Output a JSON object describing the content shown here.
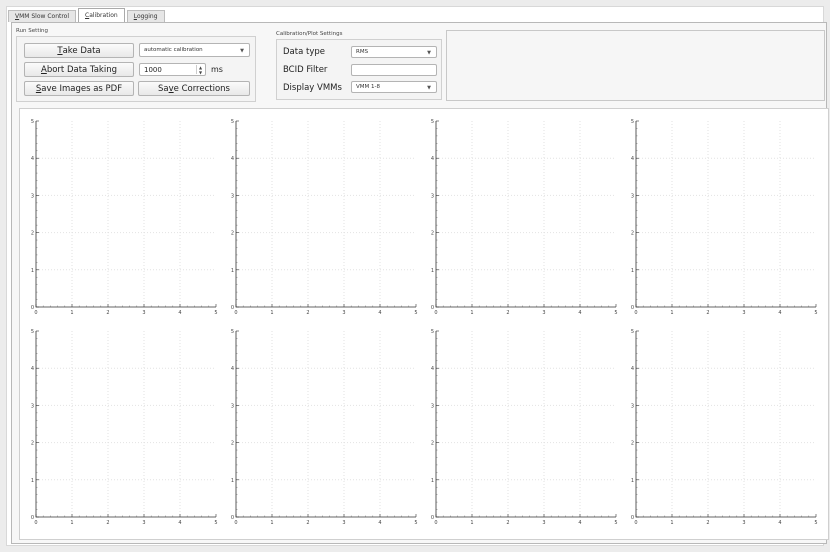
{
  "tabs": [
    {
      "label": "VMM Slow Control",
      "mnemonic": "V",
      "rest": "MM Slow Control",
      "active": false
    },
    {
      "label": "Calibration",
      "mnemonic": "C",
      "rest": "alibration",
      "active": true
    },
    {
      "label": "Logging",
      "mnemonic": "L",
      "rest": "ogging",
      "active": false
    }
  ],
  "run_setting": {
    "title": "Run Setting",
    "take_data": {
      "pre": "",
      "mn": "T",
      "post": "ake Data"
    },
    "abort": {
      "pre": "",
      "mn": "A",
      "post": "bort Data Taking"
    },
    "save_pdf": {
      "pre": "",
      "mn": "S",
      "post": "ave Images as PDF"
    },
    "save_corr": {
      "pre": "Sa",
      "mn": "v",
      "post": "e Corrections"
    },
    "calibration_mode": "automatic calibration",
    "duration_value": "1000",
    "duration_unit": "ms"
  },
  "plot_settings": {
    "title": "Calibration/Plot Settings",
    "data_type_label": "Data type",
    "data_type_value": "RMS",
    "bcid_label": "BCID Filter",
    "bcid_value": "",
    "vmms_label": "Display VMMs",
    "vmms_value": "VMM 1-8"
  },
  "plots": {
    "count": 8,
    "x_ticks": [
      "0",
      "1",
      "2",
      "3",
      "4",
      "5"
    ],
    "y_ticks": [
      "0",
      "1",
      "2",
      "3",
      "4",
      "5"
    ]
  }
}
